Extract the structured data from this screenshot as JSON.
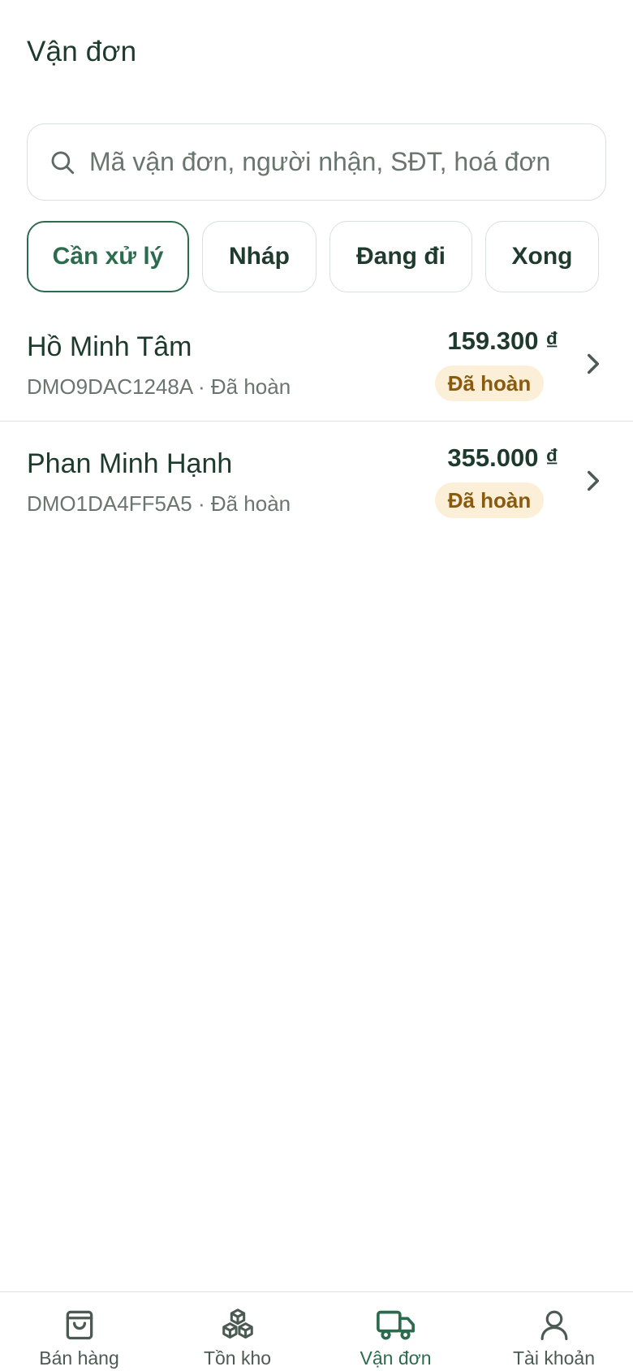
{
  "header": {
    "title": "Vận đơn"
  },
  "search": {
    "placeholder": "Mã vận đơn, người nhận, SĐT, hoá đơn",
    "value": ""
  },
  "tabs": [
    {
      "label": "Cần xử lý",
      "active": true
    },
    {
      "label": "Nháp",
      "active": false
    },
    {
      "label": "Đang đi",
      "active": false
    },
    {
      "label": "Xong",
      "active": false
    }
  ],
  "orders": [
    {
      "name": "Hồ Minh Tâm",
      "code": "DMO9DAC1248A",
      "sep": " · ",
      "sub_status": "Đã hoàn",
      "amount": "159.300 ₫",
      "badge": "Đã hoàn"
    },
    {
      "name": "Phan Minh Hạnh",
      "code": "DMO1DA4FF5A5",
      "sep": " · ",
      "sub_status": "Đã hoàn",
      "amount": "355.000 ₫",
      "badge": "Đã hoàn"
    }
  ],
  "bottom_nav": [
    {
      "label": "Bán hàng",
      "icon": "shopping-bag-icon",
      "active": false
    },
    {
      "label": "Tồn kho",
      "icon": "boxes-icon",
      "active": false
    },
    {
      "label": "Vận đơn",
      "icon": "truck-icon",
      "active": true
    },
    {
      "label": "Tài khoản",
      "icon": "user-icon",
      "active": false
    }
  ],
  "colors": {
    "primary": "#2d6b4f",
    "text": "#1e3a2d",
    "muted": "#6a7570",
    "badge_bg": "#fbf0d7",
    "badge_text": "#8a5a10",
    "border": "#d9dfdb"
  }
}
